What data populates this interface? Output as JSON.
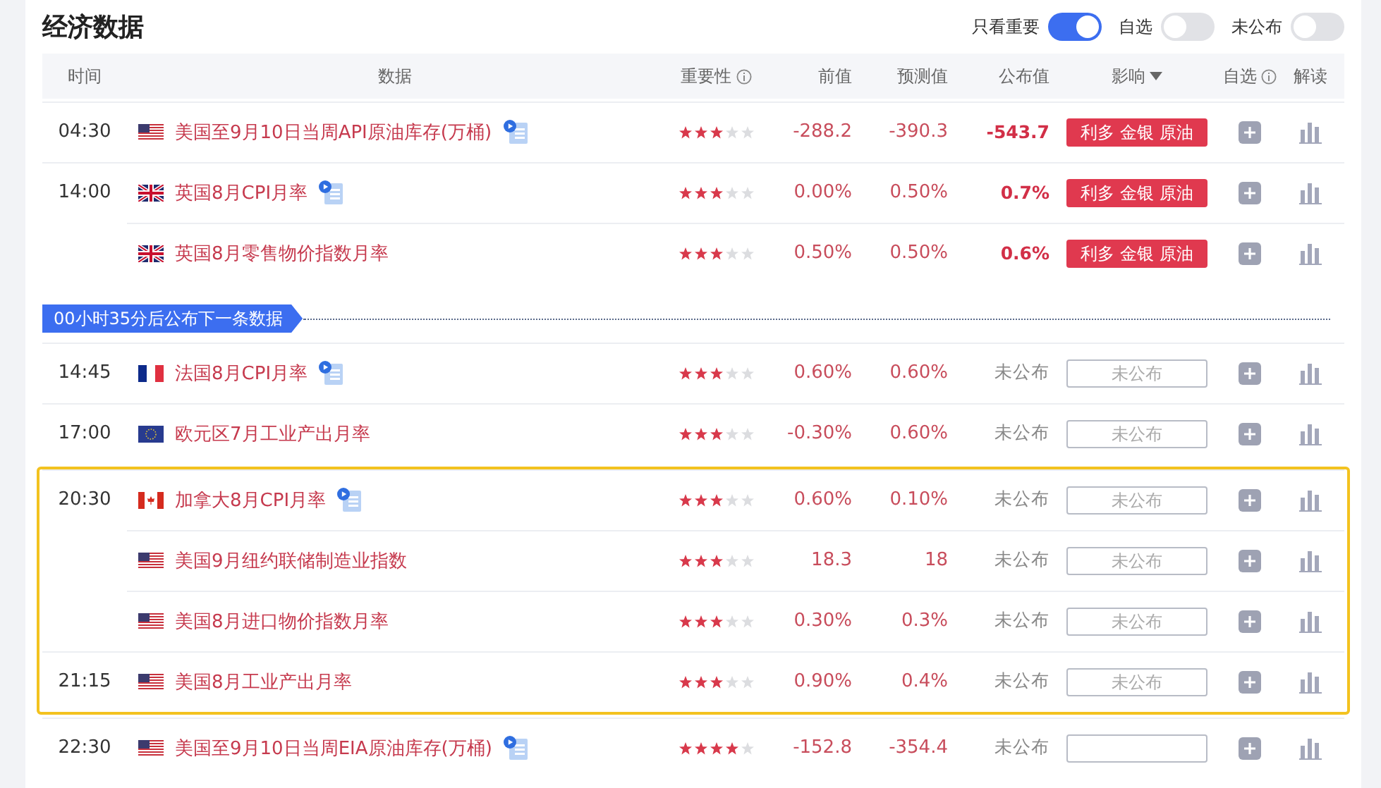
{
  "title": "经济数据",
  "filters": [
    {
      "label": "只看重要",
      "on": true
    },
    {
      "label": "自选",
      "on": false
    },
    {
      "label": "未公布",
      "on": false
    }
  ],
  "columns": [
    {
      "label": "时间",
      "kind": "plain"
    },
    {
      "label": "数据",
      "kind": "plain"
    },
    {
      "label": "重要性",
      "kind": "info"
    },
    {
      "label": "前值",
      "kind": "plain"
    },
    {
      "label": "预测值",
      "kind": "plain"
    },
    {
      "label": "公布值",
      "kind": "plain"
    },
    {
      "label": "影响",
      "kind": "sort"
    },
    {
      "label": "自选",
      "kind": "info"
    },
    {
      "label": "解读",
      "kind": "plain"
    }
  ],
  "sections": [
    {
      "kind": "rows",
      "highlighted": false,
      "rows": [
        {
          "time": "04:30",
          "flag": {
            "kind": "us"
          },
          "name": "美国至9月10日当周API原油库存(万桶)",
          "video": true,
          "stars": 3,
          "previous": "-288.2",
          "forecast": "-390.3",
          "actual": "-543.7",
          "published": true,
          "impact": {
            "kind": "tag",
            "text": "利多 金银 原油"
          }
        },
        {
          "time": "14:00",
          "flag": {
            "kind": "uk"
          },
          "name": "英国8月CPI月率",
          "video": true,
          "stars": 3,
          "previous": "0.00%",
          "forecast": "0.50%",
          "actual": "0.7%",
          "published": true,
          "impact": {
            "kind": "tag",
            "text": "利多 金银 原油"
          }
        },
        {
          "flag": {
            "kind": "uk"
          },
          "name": "英国8月零售物价指数月率",
          "video": false,
          "stars": 3,
          "previous": "0.50%",
          "forecast": "0.50%",
          "actual": "0.6%",
          "published": true,
          "impact": {
            "kind": "tag",
            "text": "利多 金银 原油"
          }
        }
      ]
    },
    {
      "kind": "countdown",
      "text": "00小时35分后公布下一条数据"
    },
    {
      "kind": "rows",
      "highlighted": false,
      "rows": [
        {
          "time": "14:45",
          "flag": {
            "kind": "fr"
          },
          "name": "法国8月CPI月率",
          "video": true,
          "stars": 3,
          "previous": "0.60%",
          "forecast": "0.60%",
          "actual": "未公布",
          "published": false,
          "impact": {
            "kind": "pending",
            "text": "未公布"
          }
        },
        {
          "time": "17:00",
          "flag": {
            "kind": "eu"
          },
          "name": "欧元区7月工业产出月率",
          "video": false,
          "stars": 3,
          "previous": "-0.30%",
          "forecast": "0.60%",
          "actual": "未公布",
          "published": false,
          "impact": {
            "kind": "pending",
            "text": "未公布"
          }
        }
      ]
    },
    {
      "kind": "rows",
      "highlighted": true,
      "rows": [
        {
          "time": "20:30",
          "flag": {
            "kind": "ca"
          },
          "name": "加拿大8月CPI月率",
          "video": true,
          "stars": 3,
          "previous": "0.60%",
          "forecast": "0.10%",
          "actual": "未公布",
          "published": false,
          "impact": {
            "kind": "pending",
            "text": "未公布"
          }
        },
        {
          "flag": {
            "kind": "us"
          },
          "name": "美国9月纽约联储制造业指数",
          "video": false,
          "stars": 3,
          "previous": "18.3",
          "forecast": "18",
          "actual": "未公布",
          "published": false,
          "impact": {
            "kind": "pending",
            "text": "未公布"
          }
        },
        {
          "flag": {
            "kind": "us"
          },
          "name": "美国8月进口物价指数月率",
          "video": false,
          "stars": 3,
          "previous": "0.30%",
          "forecast": "0.3%",
          "actual": "未公布",
          "published": false,
          "impact": {
            "kind": "pending",
            "text": "未公布"
          }
        },
        {
          "time": "21:15",
          "flag": {
            "kind": "us"
          },
          "name": "美国8月工业产出月率",
          "video": false,
          "stars": 3,
          "previous": "0.90%",
          "forecast": "0.4%",
          "actual": "未公布",
          "published": false,
          "impact": {
            "kind": "pending",
            "text": "未公布"
          }
        }
      ]
    },
    {
      "kind": "rows",
      "highlighted": false,
      "rows": [
        {
          "time": "22:30",
          "flag": {
            "kind": "us"
          },
          "name": "美国至9月10日当周EIA原油库存(万桶)",
          "video": true,
          "stars": 4,
          "previous": "-152.8",
          "forecast": "-354.4",
          "actual": "未公布",
          "published": false,
          "impact": {
            "kind": "pending"
          }
        }
      ]
    }
  ]
}
